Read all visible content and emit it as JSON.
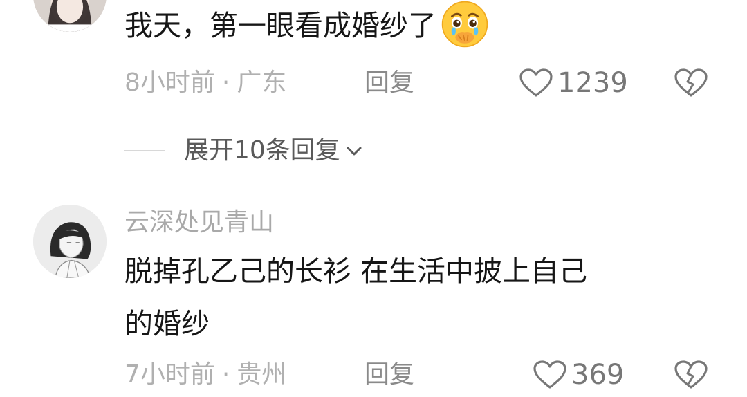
{
  "comments": [
    {
      "text": "我天，第一眼看成婚纱了",
      "emoji": "crying-covering-mouth-emoji",
      "time": "8小时前",
      "separator": "·",
      "location": "广东",
      "reply_label": "回复",
      "likes": "1239",
      "expand_replies_label": "展开10条回复"
    },
    {
      "username": "云深处见青山",
      "text_line1": "脱掉孔乙己的长衫 在生活中披上自己",
      "text_line2": "的婚纱",
      "time": "7小时前",
      "separator": "·",
      "location": "贵州",
      "reply_label": "回复",
      "likes": "369"
    }
  ],
  "icons": {
    "like": "heart-outline-icon",
    "dislike": "broken-heart-icon",
    "expand": "chevron-down-icon"
  },
  "colors": {
    "comment_text": "#161616",
    "meta_text": "#b0b0b0",
    "username": "#a9a9a9",
    "reply": "#8a8a8a",
    "like_count": "#777777"
  }
}
